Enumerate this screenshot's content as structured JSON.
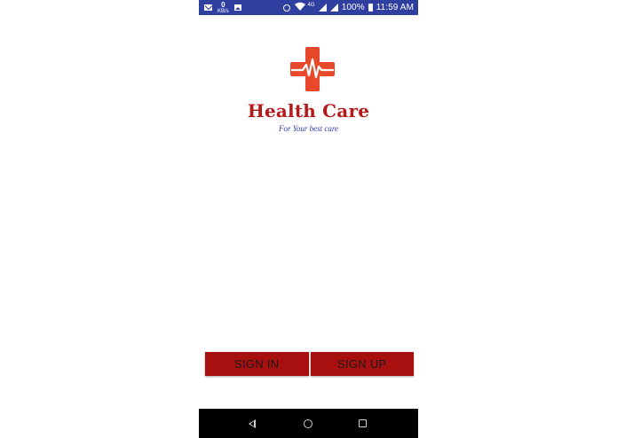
{
  "status_bar": {
    "network_speed_value": "0",
    "network_speed_unit": "KB/s",
    "network_type": "4G",
    "battery_percent": "100%",
    "time": "11:59 AM",
    "background_color": "#2f3fa0",
    "icons": [
      "mail-icon",
      "network-speed-indicator",
      "image-icon",
      "alarm-icon",
      "wifi-icon",
      "signal-icon",
      "battery-icon"
    ]
  },
  "app": {
    "title": "Health Care",
    "tagline": "For Your best care",
    "logo_icon": "medical-cross-heartbeat-icon",
    "logo_color": "#e8492a",
    "title_color": "#b51a1a",
    "tagline_color": "#2c3bb0"
  },
  "buttons": {
    "sign_in_label": "SIGN IN",
    "sign_up_label": "SIGN UP",
    "color": "#a8100f"
  },
  "nav_bar": {
    "items": [
      "back-icon",
      "home-icon",
      "recents-icon"
    ]
  }
}
